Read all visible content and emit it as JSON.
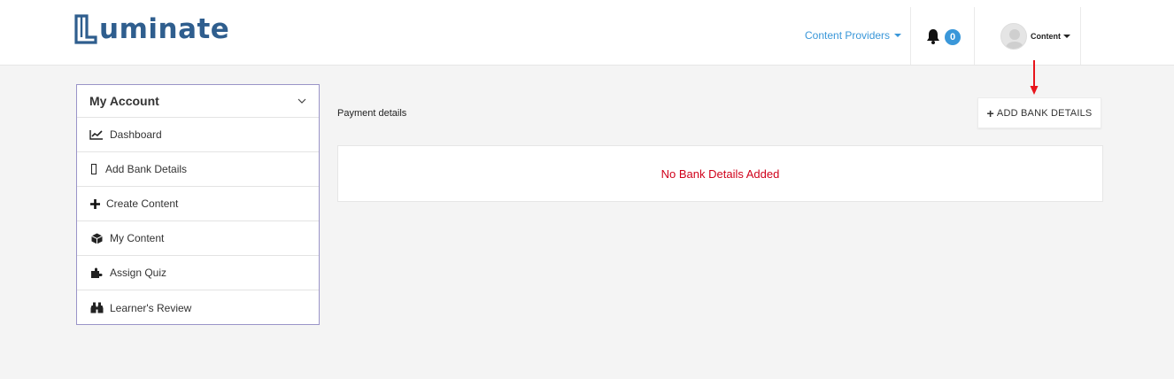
{
  "header": {
    "logo_text": "uminate",
    "nav_providers_label": "Content Providers",
    "notifications_count": "0",
    "user_label": "Content"
  },
  "sidebar": {
    "title": "My Account",
    "items": [
      {
        "label": "Dashboard",
        "icon": "line-chart-icon"
      },
      {
        "label": "Add Bank Details",
        "icon": "mobile-icon"
      },
      {
        "label": "Create Content",
        "icon": "plus-icon"
      },
      {
        "label": "My Content",
        "icon": "cube-icon"
      },
      {
        "label": "Assign Quiz",
        "icon": "puzzle-icon"
      },
      {
        "label": "Learner's Review",
        "icon": "binoculars-icon"
      }
    ]
  },
  "main": {
    "page_title": "Payment details",
    "add_button_label": "ADD BANK DETAILS",
    "empty_message": "No Bank Details Added"
  },
  "colors": {
    "brand": "#2f5e8e",
    "accent": "#3a97d9",
    "error": "#d0021b",
    "sidebar_border": "#9a94c8"
  }
}
